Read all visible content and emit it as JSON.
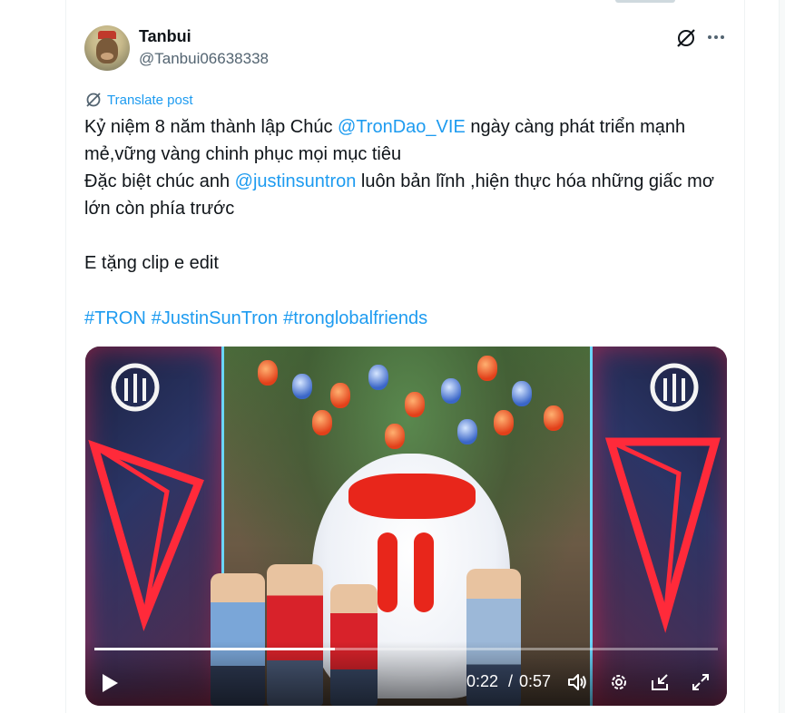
{
  "post": {
    "author": {
      "display_name": "Tanbui",
      "handle": "@Tanbui06638338"
    },
    "translate_label": "Translate post",
    "text_parts": {
      "p1": "Kỷ niệm 8 năm thành lập Chúc ",
      "mention1": "@TronDao_VIE",
      "p2": " ngày càng phát triển mạnh mẻ,vững vàng chinh phục mọi mục tiêu\nĐặc biệt chúc anh ",
      "mention2": "@justinsuntron",
      "p3": " luôn bản lĩnh ,hiện thực hóa những giấc mơ lớn còn phía trước\n\nE tặng clip e edit"
    },
    "hashtags": [
      "#TRON",
      "#JustinSunTron",
      "#tronglobalfriends"
    ],
    "video": {
      "current_time": "0:22",
      "separator": "/",
      "total_time": "0:57",
      "progress": 0.386
    }
  },
  "colors": {
    "link": "#1d9bf0",
    "text": "#0f1419",
    "secondary": "#536471",
    "tron_red": "#e8261b"
  },
  "icons": {
    "grok": "grok-icon",
    "more": "more-icon",
    "translate": "translate-icon",
    "play": "play-icon",
    "volume": "volume-icon",
    "settings": "settings-icon",
    "pip": "pip-icon",
    "fullscreen": "fullscreen-icon"
  }
}
